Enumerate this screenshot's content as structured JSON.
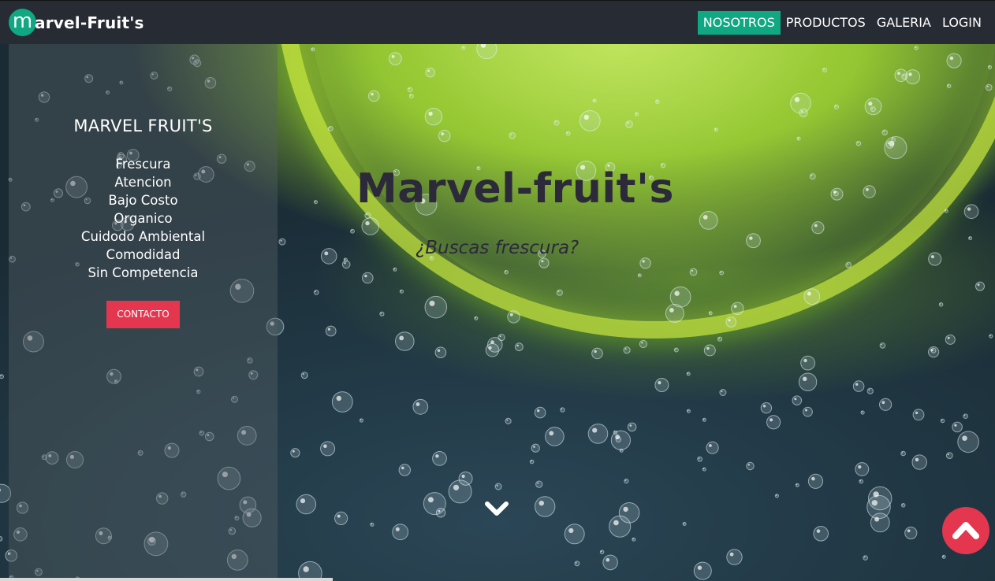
{
  "navbar": {
    "brand_logo_letter": "m",
    "brand_name": "arvel-Fruit's",
    "links": [
      {
        "label": "NOSOTROS",
        "active": true
      },
      {
        "label": "PRODUCTOS",
        "active": false
      },
      {
        "label": "GALERIA",
        "active": false
      },
      {
        "label": "LOGIN",
        "active": false
      }
    ]
  },
  "sidebar": {
    "title": "MARVEL FRUIT'S",
    "items": [
      "Frescura",
      "Atencion",
      "Bajo Costo",
      "Organico",
      "Cuidodo Ambiental",
      "Comodidad",
      "Sin Competencia"
    ],
    "contact_label": "CONTACTO"
  },
  "hero": {
    "title": "Marvel-fruit's",
    "subtitle": "¿Buscas frescura?"
  },
  "icons": {
    "scroll_down": "chevron-down-icon",
    "back_to_top": "chevron-up-icon"
  },
  "colors": {
    "navbar_bg": "#272b33",
    "accent_green": "#0fa883",
    "accent_red": "#e4364e"
  }
}
